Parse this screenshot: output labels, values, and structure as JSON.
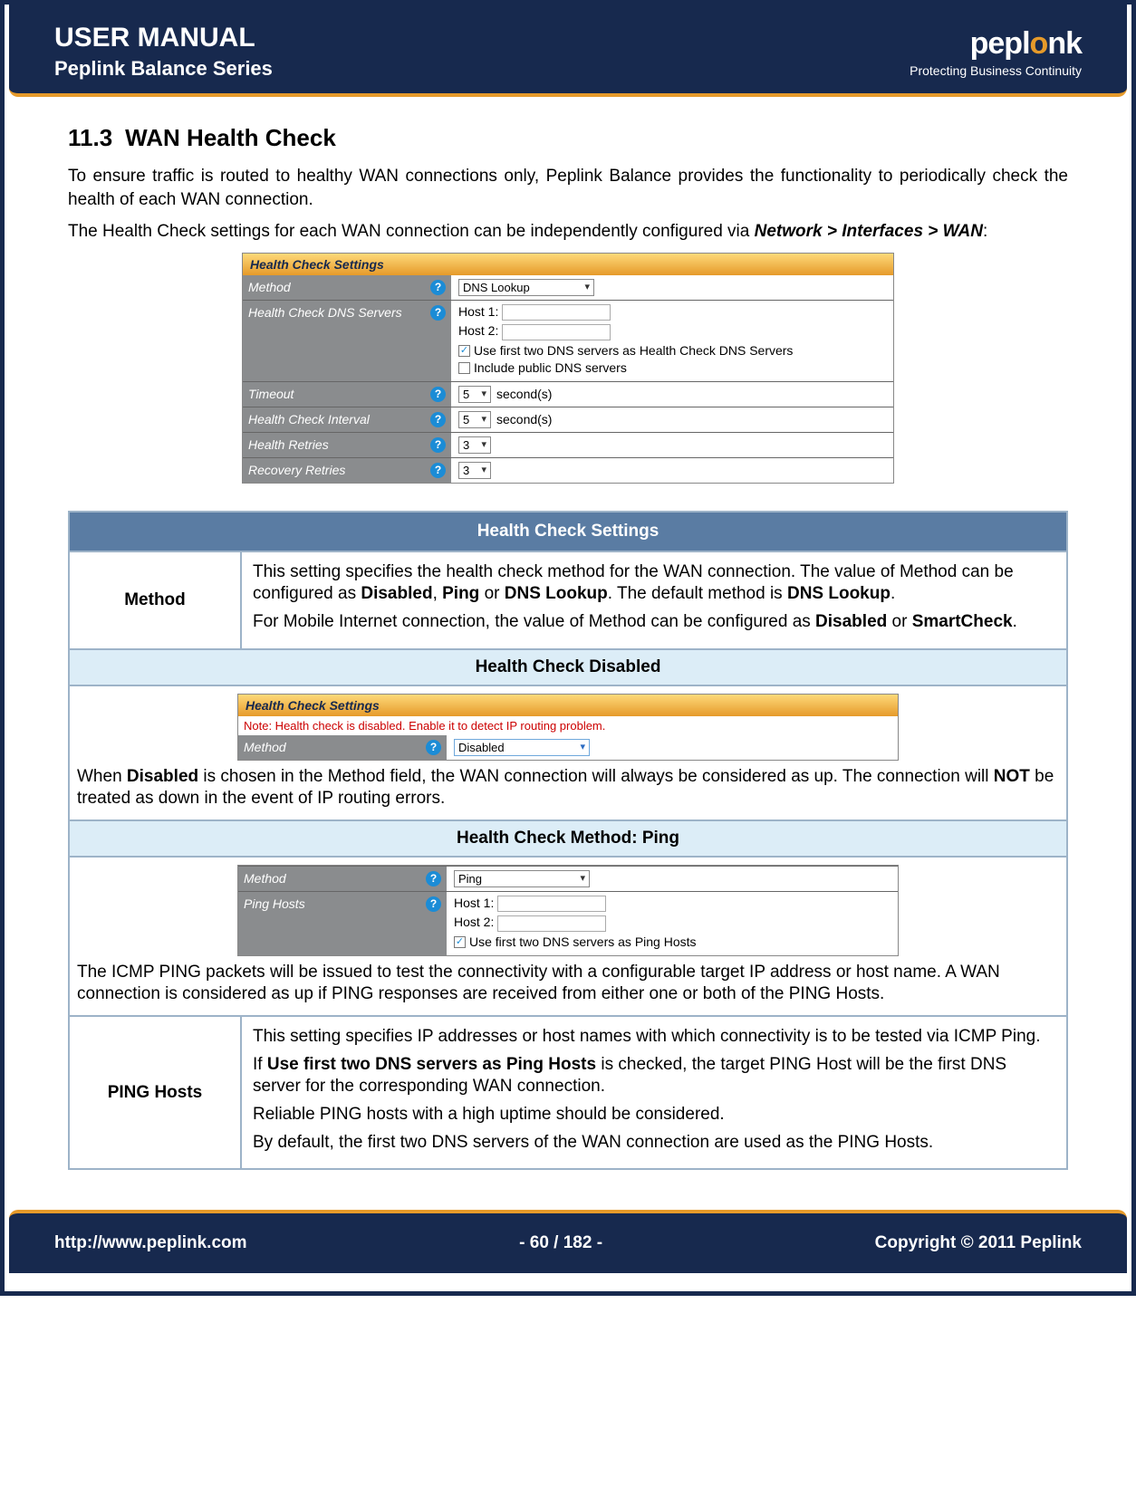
{
  "header": {
    "manual_title": "USER MANUAL",
    "series": "Peplink Balance Series",
    "logo_pre": "pepl",
    "logo_o": "o",
    "logo_post": "nk",
    "tagline": "Protecting Business Continuity"
  },
  "section": {
    "num": "11.3",
    "title": "WAN Health Check",
    "intro": "To ensure traffic is routed to healthy WAN connections only, Peplink Balance provides the functionality to periodically check the health of each WAN connection.",
    "config_text_pre": "The Health Check settings for each WAN connection can be independently configured via ",
    "nav_path": "Network > Interfaces > WAN",
    "colon": ":"
  },
  "shot1": {
    "title": "Health Check Settings",
    "method_label": "Method",
    "method_value": "DNS Lookup",
    "dns_servers_label": "Health Check DNS Servers",
    "host1": "Host 1:",
    "host2": "Host 2:",
    "cb1": "Use first two DNS servers as Health Check DNS Servers",
    "cb2": "Include public DNS servers",
    "timeout_label": "Timeout",
    "timeout_value": "5",
    "timeout_unit": "second(s)",
    "interval_label": "Health Check Interval",
    "interval_value": "5",
    "interval_unit": "second(s)",
    "retries_label": "Health Retries",
    "retries_value": "3",
    "recovery_label": "Recovery Retries",
    "recovery_value": "3"
  },
  "table": {
    "hdr": "Health Check Settings",
    "method_label": "Method",
    "method_p1a": "This setting specifies the health check method for the WAN connection. The value of Method can be configured as ",
    "method_b1": "Disabled",
    "method_sep1": ", ",
    "method_b2": "Ping",
    "method_sep2": " or ",
    "method_b3": "DNS Lookup",
    "method_p1b": ". The default method is ",
    "method_b4": "DNS Lookup",
    "method_p1c": ".",
    "method_p2a": "For Mobile Internet connection, the value of Method can be configured as ",
    "method_b5": "Disabled",
    "method_sep3": " or ",
    "method_b6": "SmartCheck",
    "method_p2b": ".",
    "subhdr_disabled": "Health Check Disabled",
    "disabled_p_a": "When ",
    "disabled_b1": "Disabled",
    "disabled_p_b": " is chosen in the Method field, the WAN connection will always be considered as up. The connection will ",
    "disabled_b2": "NOT",
    "disabled_p_c": " be treated as down in the event of IP routing errors.",
    "subhdr_ping": "Health Check Method: Ping",
    "ping_p": "The ICMP PING packets will be issued to test the connectivity with a configurable target IP address or host name.  A WAN connection is considered as up if PING responses are received from either one or both of the PING Hosts.",
    "pinghosts_label": "PING Hosts",
    "ph_p1": "This setting specifies IP addresses or host names with which connectivity is to be tested via ICMP Ping.",
    "ph_p2a": "If ",
    "ph_b1": "Use first two DNS servers as Ping Hosts",
    "ph_p2b": " is checked, the target PING Host will be the first DNS server for the corresponding WAN connection.",
    "ph_p3": "Reliable PING hosts with a high uptime should be considered.",
    "ph_p4": "By default, the first two DNS servers of the WAN connection are used as the PING Hosts."
  },
  "shot2": {
    "title": "Health Check Settings",
    "note": "Note: Health check is disabled. Enable it to detect IP routing problem.",
    "method_label": "Method",
    "method_value": "Disabled"
  },
  "shot3": {
    "method_label": "Method",
    "method_value": "Ping",
    "pinghosts_label": "Ping Hosts",
    "host1": "Host 1:",
    "host2": "Host 2:",
    "cb": "Use first two DNS servers as Ping Hosts"
  },
  "footer": {
    "url": "http://www.peplink.com",
    "page": "- 60 / 182 -",
    "copyright": "Copyright © 2011 Peplink"
  }
}
